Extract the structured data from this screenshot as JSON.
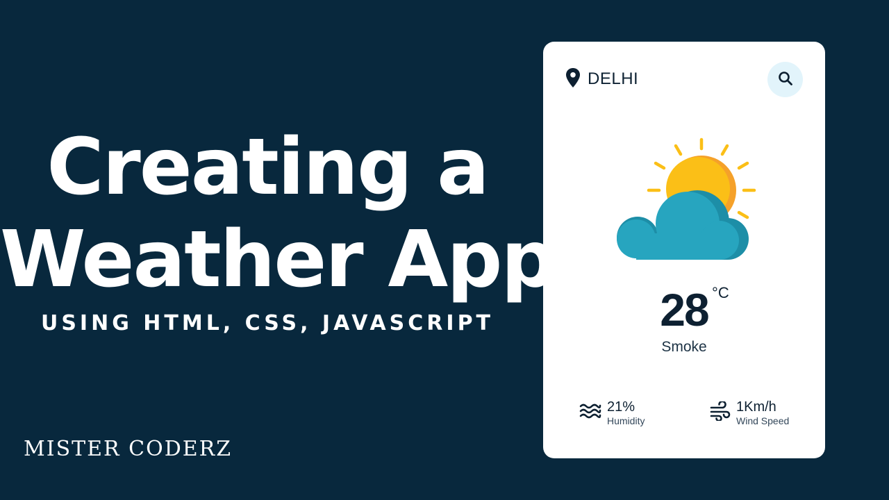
{
  "banner": {
    "headline_line1": "Creating a",
    "headline_line2": "Weather App",
    "subtitle": "USING HTML, CSS, JAVASCRIPT",
    "brand": "MISTER CODERZ"
  },
  "weather_card": {
    "location_icon": "map-pin-icon",
    "location": "DELHI",
    "search_icon": "search-icon",
    "illustration_icon": "sun-behind-cloud-icon",
    "temperature": "28",
    "temperature_unit": "°C",
    "condition": "Smoke",
    "humidity": {
      "icon": "waves-icon",
      "value": "21%",
      "label": "Humidity"
    },
    "wind": {
      "icon": "wind-icon",
      "value": "1Km/h",
      "label": "Wind Speed"
    }
  },
  "colors": {
    "background": "#08283d",
    "card": "#ffffff",
    "text_dark": "#0d2031",
    "search_bg": "#e2f4fb",
    "sun": "#fbbf17",
    "sun_shade": "#f5a12a",
    "cloud": "#27a5bf",
    "cloud_shade": "#1d8ea7"
  }
}
